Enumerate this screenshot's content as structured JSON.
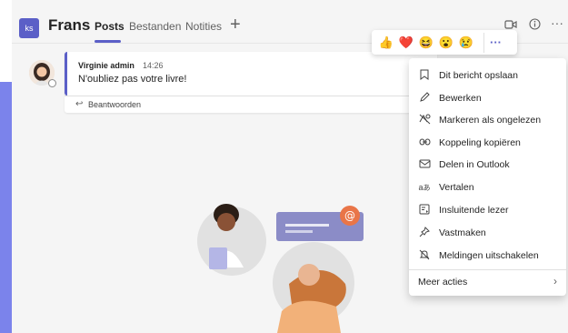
{
  "header": {
    "team_initials": "ks",
    "channel": "Frans",
    "tabs": [
      "Posts",
      "Bestanden",
      "Notities"
    ],
    "add_tab": "+",
    "icons": [
      "video-icon",
      "info-icon",
      "more-icon"
    ]
  },
  "message": {
    "author": "Virginie admin",
    "time": "14:26",
    "text": "N'oubliez pas votre livre!",
    "reply_label": "Beantwoorden"
  },
  "reactions": {
    "emojis": [
      "👍",
      "❤️",
      "😆",
      "😮",
      "😢"
    ],
    "more": "···"
  },
  "context_menu": {
    "items": [
      {
        "label": "Dit bericht opslaan",
        "icon": "bookmark-icon"
      },
      {
        "label": "Bewerken",
        "icon": "pencil-icon"
      },
      {
        "label": "Markeren als ongelezen",
        "icon": "unread-icon"
      },
      {
        "label": "Koppeling kopiëren",
        "icon": "link-icon"
      },
      {
        "label": "Delen in Outlook",
        "icon": "mail-icon"
      },
      {
        "label": "Vertalen",
        "icon": "translate-icon"
      },
      {
        "label": "Insluitende lezer",
        "icon": "immersive-reader-icon"
      },
      {
        "label": "Vastmaken",
        "icon": "pin-icon"
      },
      {
        "label": "Meldingen uitschakelen",
        "icon": "bell-off-icon"
      }
    ],
    "more_actions": "Meer acties"
  },
  "colors": {
    "accent": "#5b5fc7",
    "strip": "#7b83eb",
    "background": "#f5f5f5"
  }
}
